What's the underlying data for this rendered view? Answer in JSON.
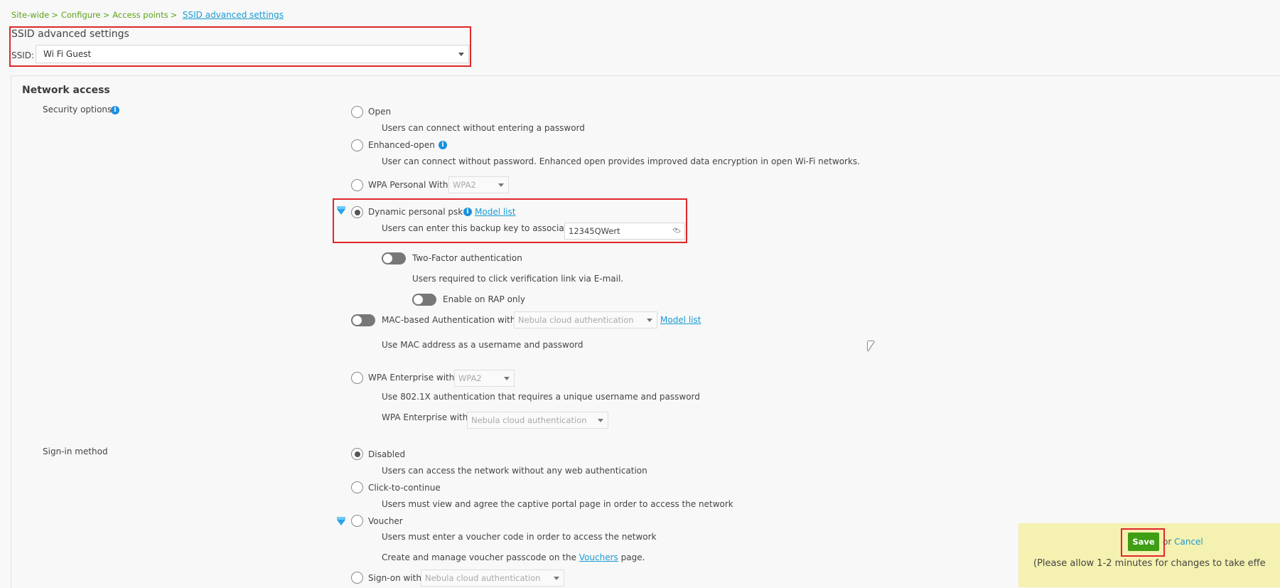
{
  "breadcrumb": {
    "items": [
      "Site-wide",
      "Configure",
      "Access points"
    ],
    "separator": ">",
    "current": "SSID advanced settings"
  },
  "header": {
    "title": "SSID advanced settings",
    "ssid_label": "SSID:",
    "ssid_value": "Wi Fi Guest"
  },
  "network_access": {
    "heading": "Network access",
    "security_label": "Security options",
    "open": {
      "label": "Open",
      "desc": "Users can connect without entering a password"
    },
    "enhanced_open": {
      "label": "Enhanced-open",
      "desc": "User can connect without password. Enhanced open provides improved data encryption in open Wi-Fi networks."
    },
    "wpa_personal": {
      "label": "WPA Personal With",
      "select": "WPA2"
    },
    "dpsk": {
      "label": "Dynamic personal psk",
      "model_link": "Model list",
      "desc": "Users can enter this backup key to associate",
      "key": "12345QWert"
    },
    "two_factor": {
      "label": "Two-Factor authentication",
      "desc": "Users required to click verification link via E-mail."
    },
    "rap_only": {
      "label": "Enable on RAP only"
    },
    "mac_auth": {
      "label": "MAC-based Authentication with",
      "select": "Nebula cloud authentication",
      "model_link": "Model list",
      "desc": "Use MAC address as a username and password"
    },
    "wpa_enterprise": {
      "label": "WPA Enterprise with",
      "select": "WPA2",
      "desc": "Use 802.1X authentication that requires a unique username and password",
      "sub_label": "WPA Enterprise with",
      "sub_select": "Nebula cloud authentication"
    }
  },
  "sign_in": {
    "label": "Sign-in method",
    "disabled": {
      "label": "Disabled",
      "desc": "Users can access the network without any web authentication"
    },
    "click": {
      "label": "Click-to-continue",
      "desc": "Users must view and agree the captive portal page in order to access the network"
    },
    "voucher": {
      "label": "Voucher",
      "desc": "Users must enter a voucher code in order to access the network",
      "manage_pre": "Create and manage voucher passcode on the",
      "manage_link": "Vouchers",
      "manage_post": "page."
    },
    "signon": {
      "label": "Sign-on with",
      "select": "Nebula cloud authentication"
    }
  },
  "footer": {
    "save": "Save",
    "or": "or",
    "cancel": "Cancel",
    "note": "(Please allow 1-2 minutes for changes to take effe"
  },
  "colors": {
    "brand_green": "#5fa21a",
    "link_blue": "#1a9ad6",
    "highlight_red": "#e0262b",
    "save_green": "#3f9e13",
    "savebar_yellow": "#f5f1b0"
  }
}
